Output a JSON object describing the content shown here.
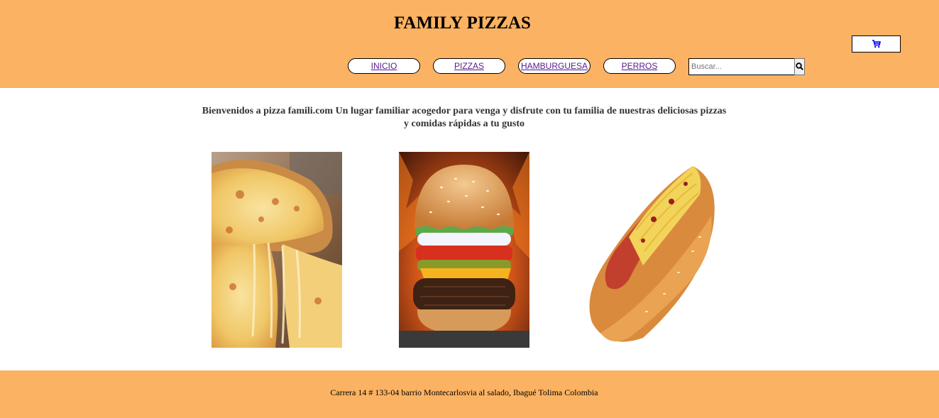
{
  "header": {
    "title": "FAMILY PIZZAS",
    "cart_icon": "cart-icon",
    "nav": [
      {
        "label": "INICIO"
      },
      {
        "label": "PIZZAS"
      },
      {
        "label": "HAMBURGUESA"
      },
      {
        "label": "PERROS"
      }
    ],
    "search": {
      "placeholder": "Buscar...",
      "value": "",
      "button_icon": "search-icon"
    }
  },
  "main": {
    "welcome_text": "Bienvenidos a pizza famili.com Un lugar familiar acogedor para venga y disfrute con tu familia de nuestras deliciosas pizzas y comidas rápidas a tu gusto",
    "products": [
      {
        "image": "pizza-slice-photo"
      },
      {
        "image": "hamburger-photo"
      },
      {
        "image": "hot-dog-photo"
      }
    ]
  },
  "footer": {
    "address": "Carrera 14 # 133-04 barrio Montecarlosvia al salado, Ibagué Tolima Colombia"
  },
  "colors": {
    "brand_orange": "#fbb262",
    "link_purple": "#551a8b"
  }
}
